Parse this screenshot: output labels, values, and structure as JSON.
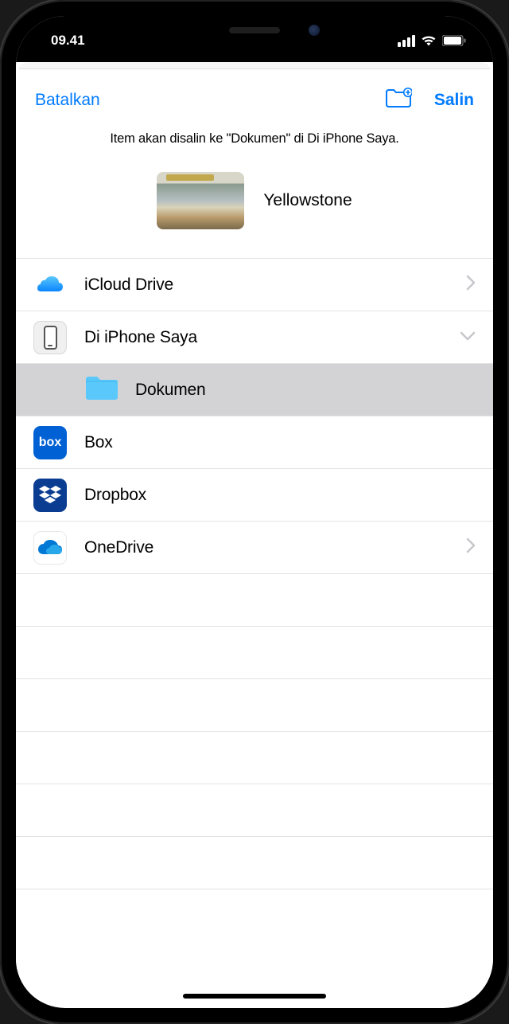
{
  "status": {
    "time": "09.41"
  },
  "toolbar": {
    "cancel": "Batalkan",
    "confirm": "Salin"
  },
  "description": "Item akan disalin ke \"Dokumen\" di Di iPhone Saya.",
  "item": {
    "name": "Yellowstone"
  },
  "locations": [
    {
      "id": "icloud",
      "label": "iCloud Drive",
      "chevron": "right"
    },
    {
      "id": "on-iphone",
      "label": "Di iPhone Saya",
      "chevron": "down"
    },
    {
      "id": "dokumen",
      "label": "Dokumen",
      "indent": true,
      "selected": true
    },
    {
      "id": "box",
      "label": "Box"
    },
    {
      "id": "dropbox",
      "label": "Dropbox"
    },
    {
      "id": "onedrive",
      "label": "OneDrive",
      "chevron": "right"
    }
  ],
  "colors": {
    "accent": "#007aff",
    "folder": "#5ac8fa"
  }
}
